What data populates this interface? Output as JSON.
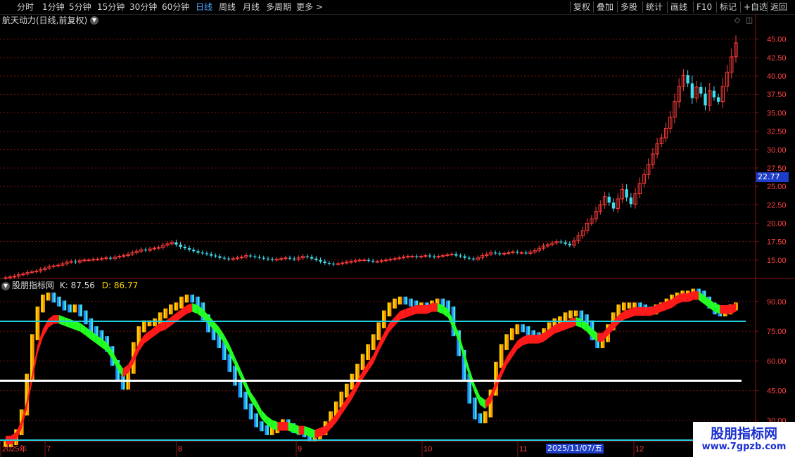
{
  "toolbar": {
    "left": [
      "分时",
      "1分钟",
      "5分钟",
      "15分钟",
      "30分钟",
      "60分钟",
      "日线",
      "周线",
      "月线",
      "多周期",
      "更多 >"
    ],
    "active": "日线",
    "right": [
      "复权",
      "叠加",
      "多股",
      "统计",
      "画线",
      "F10",
      "标记",
      "+自选",
      "返回"
    ]
  },
  "stock_title": "航天动力(日线,前复权)",
  "indicator": {
    "name": "股朋指标网",
    "k_label": "K: 87.56",
    "d_label": "D: 86.77"
  },
  "price_tag": "22.77",
  "cursor_date": "2025/11/07/五",
  "watermark": {
    "main": "股朋指标网",
    "url": "www.7gpzb.com"
  },
  "colors": {
    "up": "#ff3b3b",
    "down": "#3ee0f0",
    "grid": "#7a1010",
    "yellow": "#ffd400",
    "orange": "#ff9a00",
    "blue": "#1e90ff",
    "red_ribbon": "#ff1a1a",
    "green_ribbon": "#22ff22",
    "cyan_line": "#20d0e0"
  },
  "chart_data": [
    {
      "type": "candlestick",
      "title": "航天动力(日线,前复权)",
      "y_ticks": [
        "45.00",
        "42.50",
        "40.00",
        "37.50",
        "35.00",
        "32.50",
        "30.00",
        "27.50",
        "25.00",
        "22.50",
        "20.00",
        "17.50",
        "15.00"
      ],
      "ylim": [
        12.5,
        46.5
      ],
      "x_labels": [
        "2025年",
        "7",
        "8",
        "9",
        "10",
        "11",
        "12"
      ],
      "close": [
        12.6,
        12.7,
        12.8,
        13.0,
        13.1,
        13.3,
        13.4,
        13.5,
        13.7,
        13.9,
        14.1,
        14.2,
        14.3,
        14.5,
        14.7,
        14.8,
        14.7,
        14.9,
        15.0,
        15.0,
        15.1,
        15.1,
        15.2,
        15.3,
        15.2,
        15.4,
        15.5,
        15.6,
        15.8,
        16.0,
        16.2,
        16.4,
        16.3,
        16.5,
        16.6,
        16.7,
        17.0,
        17.2,
        17.4,
        17.1,
        16.8,
        16.6,
        16.4,
        16.2,
        16.0,
        15.9,
        15.8,
        15.6,
        15.5,
        15.3,
        15.2,
        15.1,
        15.2,
        15.3,
        15.4,
        15.6,
        15.5,
        15.4,
        15.3,
        15.2,
        15.1,
        15.0,
        15.1,
        15.2,
        15.3,
        15.2,
        15.1,
        15.3,
        15.5,
        15.4,
        15.2,
        15.0,
        14.8,
        14.6,
        14.5,
        14.4,
        14.5,
        14.6,
        14.7,
        14.8,
        14.9,
        15.0,
        15.0,
        14.9,
        14.8,
        14.8,
        14.9,
        15.0,
        15.1,
        15.2,
        15.3,
        15.4,
        15.5,
        15.5,
        15.4,
        15.5,
        15.6,
        15.5,
        15.4,
        15.5,
        15.6,
        15.7,
        15.8,
        15.6,
        15.5,
        15.3,
        15.2,
        15.1,
        15.3,
        15.6,
        15.8,
        16.0,
        15.9,
        15.8,
        15.9,
        16.0,
        16.1,
        16.0,
        16.0,
        15.9,
        16.1,
        16.3,
        16.6,
        16.9,
        17.1,
        17.3,
        17.5,
        17.4,
        17.2,
        17.0,
        17.6,
        18.3,
        19.0,
        20.0,
        20.6,
        21.6,
        22.5,
        23.6,
        22.8,
        22.0,
        23.3,
        24.6,
        23.5,
        22.6,
        24.0,
        25.4,
        26.6,
        28.0,
        29.4,
        30.8,
        31.6,
        32.9,
        34.4,
        36.5,
        38.6,
        40.1,
        39.0,
        37.0,
        38.5,
        37.6,
        36.0,
        38.0,
        37.1,
        36.5,
        38.6,
        40.5,
        42.6,
        44.5
      ],
      "current": 22.77
    },
    {
      "type": "line",
      "title": "股朋指标网",
      "y_ticks": [
        "90.00",
        "75.00",
        "60.00",
        "45.00",
        "30.00"
      ],
      "ylim": [
        20,
        96
      ],
      "levels": [
        80,
        50,
        20
      ],
      "k": 87.56,
      "d": 86.77,
      "k_series": [
        18,
        19,
        24,
        34,
        52,
        72,
        86,
        92,
        93,
        91,
        89,
        87,
        86,
        87,
        84,
        80,
        76,
        74,
        71,
        66,
        59,
        51,
        47,
        55,
        68,
        76,
        79,
        79,
        80,
        83,
        85,
        87,
        88,
        91,
        92,
        91,
        88,
        82,
        76,
        72,
        68,
        62,
        56,
        49,
        43,
        37,
        32,
        28,
        26,
        24,
        25,
        27,
        29,
        27,
        25,
        24,
        23,
        21,
        22,
        24,
        28,
        33,
        38,
        43,
        47,
        52,
        57,
        62,
        67,
        72,
        78,
        84,
        88,
        90,
        91,
        90,
        89,
        88,
        88,
        87,
        89,
        90,
        89,
        86,
        74,
        64,
        52,
        40,
        32,
        30,
        33,
        44,
        58,
        67,
        72,
        75,
        77,
        76,
        74,
        73,
        72,
        75,
        78,
        80,
        81,
        83,
        84,
        84,
        82,
        79,
        72,
        68,
        71,
        77,
        83,
        87,
        88,
        88,
        88,
        87,
        86,
        85,
        87,
        88,
        90,
        92,
        93,
        94,
        94,
        95,
        94,
        91,
        88,
        85,
        84,
        85,
        87,
        88
      ],
      "d_series": [
        20,
        20,
        22,
        28,
        38,
        52,
        66,
        74,
        79,
        81,
        81,
        80,
        79,
        78,
        77,
        75,
        73,
        71,
        69,
        67,
        63,
        58,
        54,
        56,
        61,
        67,
        71,
        73,
        75,
        77,
        78,
        80,
        82,
        84,
        86,
        87,
        86,
        84,
        81,
        78,
        75,
        71,
        66,
        60,
        54,
        48,
        42,
        38,
        33,
        30,
        28,
        27,
        27,
        27,
        26,
        25,
        25,
        24,
        23,
        24,
        25,
        28,
        31,
        35,
        39,
        43,
        48,
        53,
        57,
        61,
        67,
        72,
        77,
        80,
        83,
        84,
        85,
        86,
        86,
        86,
        87,
        87,
        86,
        84,
        78,
        72,
        63,
        54,
        46,
        40,
        38,
        41,
        48,
        54,
        60,
        64,
        68,
        70,
        71,
        71,
        71,
        72,
        74,
        76,
        77,
        78,
        79,
        80,
        79,
        77,
        74,
        72,
        72,
        75,
        78,
        81,
        83,
        84,
        85,
        85,
        85,
        85,
        86,
        87,
        88,
        89,
        91,
        92,
        92,
        93,
        93,
        91,
        89,
        87,
        86,
        86,
        86,
        87
      ]
    }
  ]
}
